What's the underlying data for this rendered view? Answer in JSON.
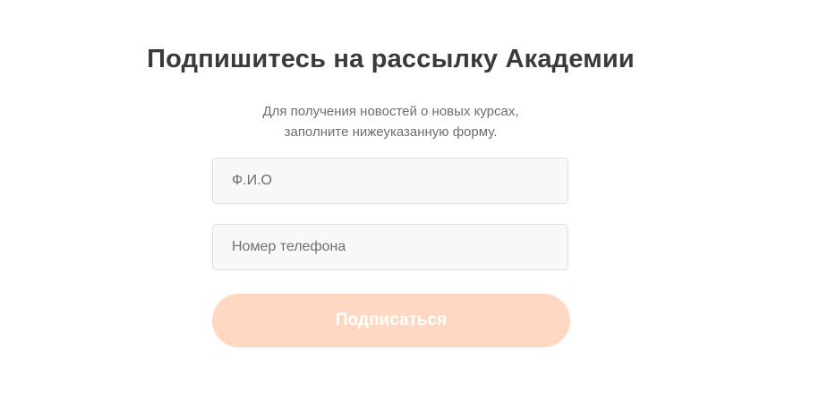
{
  "form": {
    "title": "Подпишитесь на рассылку Академии",
    "subtitle_line1": "Для получения новостей о новых курсах,",
    "subtitle_line2": "заполните нижеуказанную форму.",
    "name_placeholder": "Ф.И.О",
    "name_value": "",
    "phone_placeholder": "Номер телефона",
    "phone_value": "",
    "submit_label": "Подписаться"
  },
  "colors": {
    "title": "#3a3a3a",
    "subtitle": "#6e6e6e",
    "field_background": "#f8f8f8",
    "field_border": "#dedede",
    "button_background": "#fed8c2",
    "button_text": "#ffffff"
  }
}
